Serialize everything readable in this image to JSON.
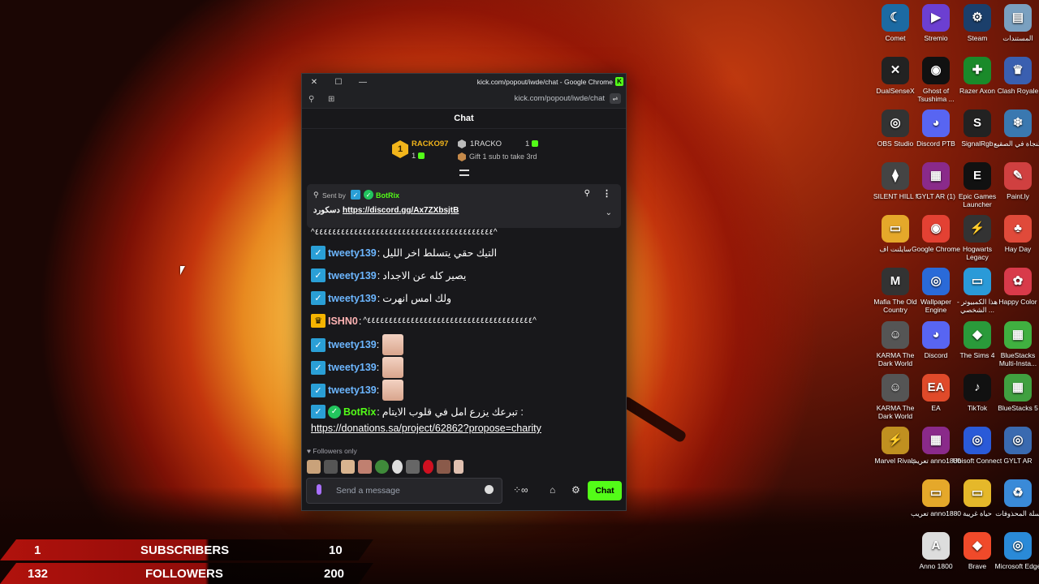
{
  "window": {
    "title": "kick.com/popout/iwde/chat - Google Chrome",
    "url": "kick.com/popout/iwde/chat",
    "close": "✕",
    "maximize": "☐",
    "minimize": "—"
  },
  "chat": {
    "header": "Chat",
    "leaderboard": {
      "first": {
        "rank": "1",
        "name": "RACKO97",
        "count": "1"
      },
      "second": {
        "name": "1RACKO",
        "count": "1",
        "hint": "Gift 1 sub to take 3rd"
      }
    },
    "pinned": {
      "sent_by": "Sent by",
      "author": "BotRix",
      "text_label": "دسكورد :",
      "link": "https://discord.gg/Ax7ZXbsjtB"
    },
    "messages": [
      {
        "user": "",
        "text": "^٤٤٤٤٤٤٤٤٤٤٤٤٤٤٤٤٤٤٤٤٤٤٤٤٤٤٤٤٤٤٤٤٤٤٤٤٤٤٤٤٤^"
      },
      {
        "user": "tweety139",
        "sep": ":",
        "text": "التيك حقي يتسلط اخر الليل"
      },
      {
        "user": "tweety139",
        "sep": ":",
        "text": "يصير كله عن الاجداد"
      },
      {
        "user": "tweety139",
        "sep": ":",
        "text": "ولك امس انهرت"
      },
      {
        "user": "ISHN0",
        "sep": ":",
        "text": "^٤٤٤٤٤٤٤٤٤٤٤٤٤٤٤٤٤٤٤٤٤٤٤٤٤٤٤٤٤٤٤٤٤٤٤٤٤٤^"
      },
      {
        "user": "tweety139",
        "sep": ":",
        "text": ""
      },
      {
        "user": "tweety139",
        "sep": ":",
        "text": ""
      },
      {
        "user": "tweety139",
        "sep": ":",
        "text": ""
      },
      {
        "user": "BotRix",
        "sep": ":",
        "text": "تبرعك يزرع امل في قلوب الايتام :",
        "link": "https://donations.sa/project/62862?propose=charity"
      }
    ],
    "followers_only": "Followers only",
    "input_placeholder": "Send a message",
    "send_label": "Chat"
  },
  "desktop_icons": [
    "Comet",
    "Stremio",
    "Steam",
    "المستندات",
    "DualSenseX",
    "Ghost of Tsushima ...",
    "Razer Axon",
    "Clash Royale",
    "OBS Studio",
    "Discord PTB",
    "SignalRgb",
    "النجاة في الصقيع",
    "SILENT HILL f",
    "GYLT AR (1)",
    "Epic Games Launcher",
    "Paint.ly",
    "سايلنت اف",
    "Google Chrome",
    "Hogwarts Legacy",
    "Hay Day",
    "Mafia The Old Country",
    "Wallpaper Engine",
    "هذا الكمبيوتر - الشخصي ...",
    "Happy Color",
    "KARMA The Dark World",
    "Discord",
    "The Sims 4",
    "BlueStacks Multi-Insta...",
    "KARMA The Dark World",
    "EA",
    "TikTok",
    "BlueStacks 5",
    "Marvel Rivals",
    "تعريب anno1880",
    "Ubisoft Connect",
    "GYLT AR",
    "تعريب anno1880",
    "حياة غريبة",
    "سلة المحذوفات",
    "Anno 1800",
    "Brave",
    "Microsoft Edge"
  ],
  "overlay": {
    "subs": {
      "current": "1",
      "label": "SUBSCRIBERS",
      "goal": "10"
    },
    "followers": {
      "current": "132",
      "label": "FOLLOWERS",
      "goal": "200"
    }
  }
}
